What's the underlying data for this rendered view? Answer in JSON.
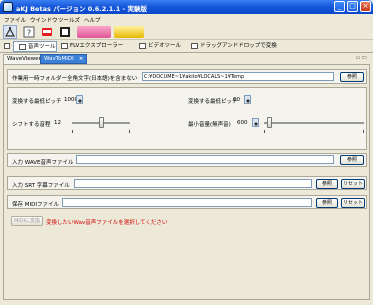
{
  "window": {
    "title": "aKJ Betas バージョン 0.6.2.1.1 - 実験版",
    "minimize": "_",
    "maximize": "□",
    "close": "×"
  },
  "menu": [
    "ファイル",
    "ウインドウ",
    "ツールズ",
    "ヘルプ"
  ],
  "toolbar": {
    "buttons": [
      "settings-icon",
      "help-icon",
      "video-icon",
      "film-icon",
      "pink-logo-icon",
      "yellow-logo-icon"
    ]
  },
  "tool_tabs": [
    {
      "label": "音声ツール",
      "active": true
    },
    {
      "label": "FLVエクスプローラー",
      "active": false
    },
    {
      "label": "ビデオツール",
      "active": false
    },
    {
      "label": "ドラッグアンドドロップで変換",
      "active": false
    }
  ],
  "doc_tabs": [
    {
      "label": "WaveViewer",
      "active": false
    },
    {
      "label": "WavToMIDI",
      "active": true,
      "close": "×"
    }
  ],
  "panel_controls": "▫ ▭",
  "work_folder": {
    "label": "作業用一時フォルダー全角文字(日本語)を含まない",
    "value": "C:¥DOCUME~1¥akito¥LOCALS~1¥Temp",
    "button": "参照"
  },
  "settings": {
    "min_pitch_label": "変換する最低ピッチ",
    "min_pitch_value": "1000",
    "max_pitch_label": "変換する最低ピッチ",
    "max_pitch_value": "60",
    "shift_label": "シフトする音程",
    "shift_value": "12",
    "shift_slider_value": 0.5,
    "min_volume_label": "最小音量(無声音)",
    "min_volume_value": "600",
    "min_volume_slider_value": 0.03
  },
  "input_wave": {
    "label": "入力 WAVE音声ファイル",
    "value": "",
    "button": "参照"
  },
  "input_srt": {
    "label": "入力 SRT 字幕ファイル",
    "value": "",
    "button": "参照",
    "reset": "リセット"
  },
  "save_midi": {
    "label": "保存 MIDIファイル",
    "value": "",
    "button": "参照",
    "reset": "リセット"
  },
  "convert": {
    "button": "MIDIに変換",
    "status": "変換したいWav音声ファイルを選択してください"
  }
}
